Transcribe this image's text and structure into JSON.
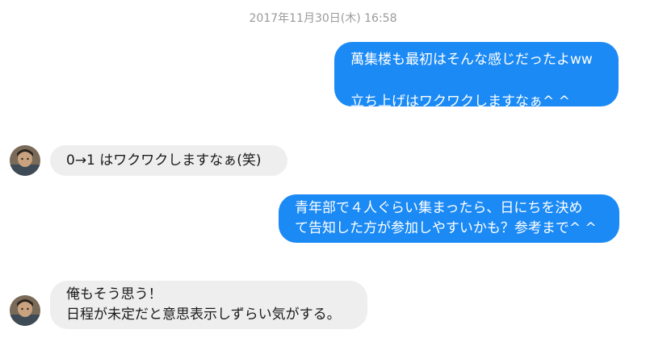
{
  "conversation": {
    "timestamp": "2017年11月30日(木) 16:58",
    "messages": [
      {
        "direction": "outgoing",
        "text": "萬集楼も最初はそんな感じだったよww\n\n立ち上げはワクワクしますなぁ^ ^"
      },
      {
        "direction": "incoming",
        "text": "0→1 はワクワクしますなぁ(笑)"
      },
      {
        "direction": "outgoing",
        "text": "青年部で４人ぐらい集まったら、日にちを決め\nて告知した方が参加しやすいかも？参考まで^ ^"
      },
      {
        "direction": "incoming",
        "text": "俺もそう思う！\n日程が未定だと意思表示しずらい気がする。"
      }
    ]
  },
  "colors": {
    "outgoing_bubble": "#1b8af5",
    "incoming_bubble": "#eeeeee",
    "timestamp_text": "#9a9a9a"
  },
  "icons": {
    "avatar": "contact-avatar-photo"
  }
}
